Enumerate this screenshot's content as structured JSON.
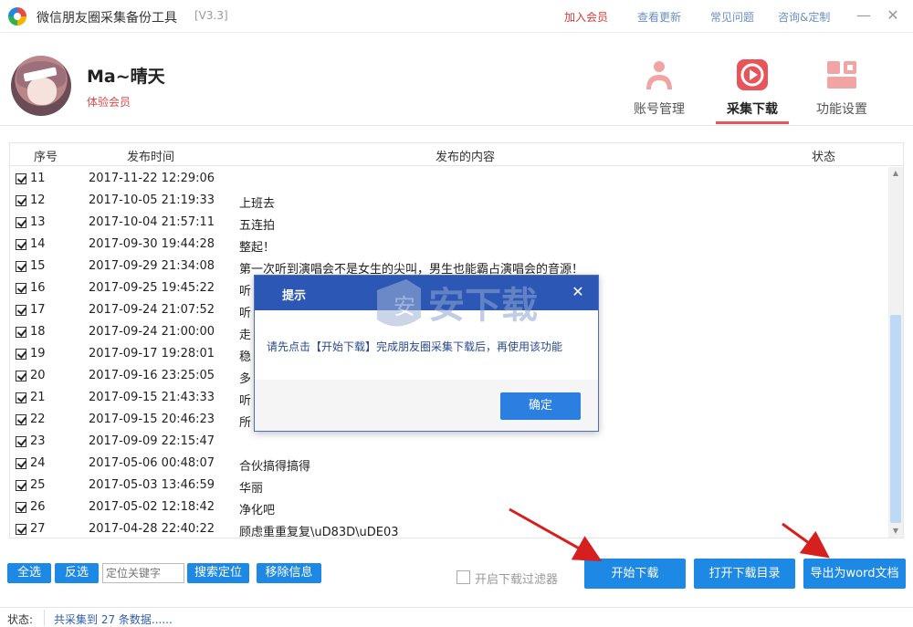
{
  "window": {
    "title": "微信朋友圈采集备份工具",
    "version": "[V3.3]",
    "links": [
      "加入会员",
      "查看更新",
      "常见问题",
      "咨询&定制"
    ],
    "minimize": "—",
    "close": "✕"
  },
  "user": {
    "name": "Ma~晴天",
    "level": "体验会员"
  },
  "nav": {
    "tabs": [
      {
        "label": "账号管理",
        "icon": "user-icon"
      },
      {
        "label": "采集下载",
        "icon": "play-icon",
        "active": true
      },
      {
        "label": "功能设置",
        "icon": "settings-icon"
      }
    ],
    "accent_color": "#e7545a"
  },
  "table": {
    "columns": [
      "序号",
      "发布时间",
      "发布的内容",
      "状态"
    ],
    "rows": [
      {
        "no": "11",
        "date": "2017-11-22  12:29:06",
        "content": ""
      },
      {
        "no": "12",
        "date": "2017-10-05  21:19:33",
        "content": "上班去"
      },
      {
        "no": "13",
        "date": "2017-10-04  21:57:11",
        "content": "五连拍"
      },
      {
        "no": "14",
        "date": "2017-09-30  19:44:28",
        "content": "整起！"
      },
      {
        "no": "15",
        "date": "2017-09-29  21:34:08",
        "content": "第一次听到演唱会不是女生的尖叫，男生也能霸占演唱会的音源！"
      },
      {
        "no": "16",
        "date": "2017-09-25  19:45:22",
        "content": "听"
      },
      {
        "no": "17",
        "date": "2017-09-24  21:07:52",
        "content": "听                                                              人的手机，第二是妹子卸妆以后..."
      },
      {
        "no": "18",
        "date": "2017-09-24  21:00:00",
        "content": "走"
      },
      {
        "no": "19",
        "date": "2017-09-17  19:28:01",
        "content": "稳"
      },
      {
        "no": "20",
        "date": "2017-09-16  23:25:05",
        "content": "多"
      },
      {
        "no": "21",
        "date": "2017-09-15  21:43:33",
        "content": "听                                                              保持冷静，阿迪达斯五折的球鞋..."
      },
      {
        "no": "22",
        "date": "2017-09-15  20:46:23",
        "content": "所"
      },
      {
        "no": "23",
        "date": "2017-09-09  22:15:47",
        "content": ""
      },
      {
        "no": "24",
        "date": "2017-05-06  00:48:07",
        "content": "合伙搞得搞得"
      },
      {
        "no": "25",
        "date": "2017-05-03  13:46:59",
        "content": "华丽"
      },
      {
        "no": "26",
        "date": "2017-05-02  12:18:42",
        "content": "净化吧"
      },
      {
        "no": "27",
        "date": "2017-04-28  22:40:22",
        "content": "顾虑重重复复\\uD83D\\uDE03"
      }
    ]
  },
  "toolbar": {
    "select_all": "全选",
    "invert": "反选",
    "keyword_placeholder": "定位关键字",
    "search_locate": "搜索定位",
    "remove_info": "移除信息",
    "filter_label": "开启下载过滤器",
    "start_download": "开始下载",
    "open_dir": "打开下载目录",
    "export_word": "导出为word文档",
    "button_color": "#1e88e5"
  },
  "status": {
    "label": "状态:",
    "text": "共采集到 27 条数据......"
  },
  "dialog": {
    "title": "提示",
    "message": "请先点击【开始下载】完成朋友圈采集下载后，再使用该功能",
    "ok": "确定",
    "close": "✕"
  },
  "watermark": {
    "text": "安下载"
  }
}
